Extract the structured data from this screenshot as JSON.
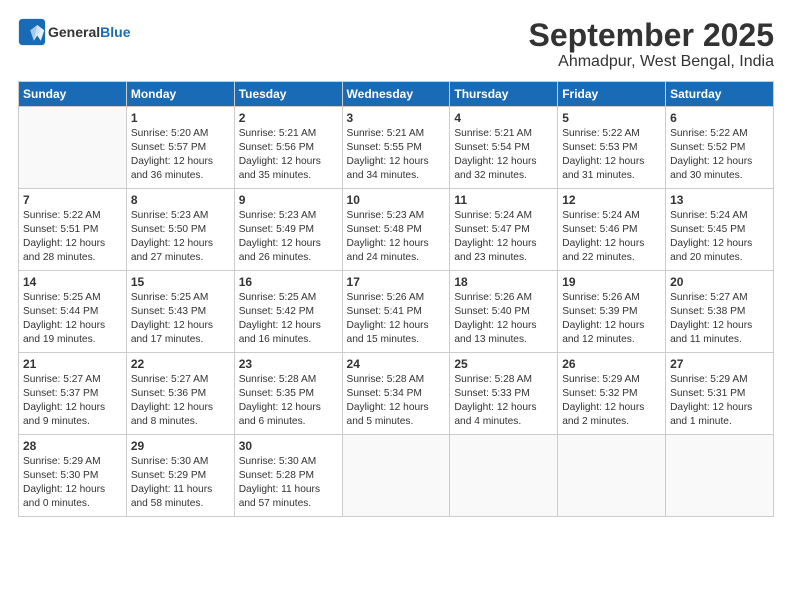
{
  "header": {
    "logo_general": "General",
    "logo_blue": "Blue",
    "month": "September 2025",
    "location": "Ahmadpur, West Bengal, India"
  },
  "days_of_week": [
    "Sunday",
    "Monday",
    "Tuesday",
    "Wednesday",
    "Thursday",
    "Friday",
    "Saturday"
  ],
  "weeks": [
    [
      {
        "day": "",
        "info": ""
      },
      {
        "day": "1",
        "info": "Sunrise: 5:20 AM\nSunset: 5:57 PM\nDaylight: 12 hours\nand 36 minutes."
      },
      {
        "day": "2",
        "info": "Sunrise: 5:21 AM\nSunset: 5:56 PM\nDaylight: 12 hours\nand 35 minutes."
      },
      {
        "day": "3",
        "info": "Sunrise: 5:21 AM\nSunset: 5:55 PM\nDaylight: 12 hours\nand 34 minutes."
      },
      {
        "day": "4",
        "info": "Sunrise: 5:21 AM\nSunset: 5:54 PM\nDaylight: 12 hours\nand 32 minutes."
      },
      {
        "day": "5",
        "info": "Sunrise: 5:22 AM\nSunset: 5:53 PM\nDaylight: 12 hours\nand 31 minutes."
      },
      {
        "day": "6",
        "info": "Sunrise: 5:22 AM\nSunset: 5:52 PM\nDaylight: 12 hours\nand 30 minutes."
      }
    ],
    [
      {
        "day": "7",
        "info": "Sunrise: 5:22 AM\nSunset: 5:51 PM\nDaylight: 12 hours\nand 28 minutes."
      },
      {
        "day": "8",
        "info": "Sunrise: 5:23 AM\nSunset: 5:50 PM\nDaylight: 12 hours\nand 27 minutes."
      },
      {
        "day": "9",
        "info": "Sunrise: 5:23 AM\nSunset: 5:49 PM\nDaylight: 12 hours\nand 26 minutes."
      },
      {
        "day": "10",
        "info": "Sunrise: 5:23 AM\nSunset: 5:48 PM\nDaylight: 12 hours\nand 24 minutes."
      },
      {
        "day": "11",
        "info": "Sunrise: 5:24 AM\nSunset: 5:47 PM\nDaylight: 12 hours\nand 23 minutes."
      },
      {
        "day": "12",
        "info": "Sunrise: 5:24 AM\nSunset: 5:46 PM\nDaylight: 12 hours\nand 22 minutes."
      },
      {
        "day": "13",
        "info": "Sunrise: 5:24 AM\nSunset: 5:45 PM\nDaylight: 12 hours\nand 20 minutes."
      }
    ],
    [
      {
        "day": "14",
        "info": "Sunrise: 5:25 AM\nSunset: 5:44 PM\nDaylight: 12 hours\nand 19 minutes."
      },
      {
        "day": "15",
        "info": "Sunrise: 5:25 AM\nSunset: 5:43 PM\nDaylight: 12 hours\nand 17 minutes."
      },
      {
        "day": "16",
        "info": "Sunrise: 5:25 AM\nSunset: 5:42 PM\nDaylight: 12 hours\nand 16 minutes."
      },
      {
        "day": "17",
        "info": "Sunrise: 5:26 AM\nSunset: 5:41 PM\nDaylight: 12 hours\nand 15 minutes."
      },
      {
        "day": "18",
        "info": "Sunrise: 5:26 AM\nSunset: 5:40 PM\nDaylight: 12 hours\nand 13 minutes."
      },
      {
        "day": "19",
        "info": "Sunrise: 5:26 AM\nSunset: 5:39 PM\nDaylight: 12 hours\nand 12 minutes."
      },
      {
        "day": "20",
        "info": "Sunrise: 5:27 AM\nSunset: 5:38 PM\nDaylight: 12 hours\nand 11 minutes."
      }
    ],
    [
      {
        "day": "21",
        "info": "Sunrise: 5:27 AM\nSunset: 5:37 PM\nDaylight: 12 hours\nand 9 minutes."
      },
      {
        "day": "22",
        "info": "Sunrise: 5:27 AM\nSunset: 5:36 PM\nDaylight: 12 hours\nand 8 minutes."
      },
      {
        "day": "23",
        "info": "Sunrise: 5:28 AM\nSunset: 5:35 PM\nDaylight: 12 hours\nand 6 minutes."
      },
      {
        "day": "24",
        "info": "Sunrise: 5:28 AM\nSunset: 5:34 PM\nDaylight: 12 hours\nand 5 minutes."
      },
      {
        "day": "25",
        "info": "Sunrise: 5:28 AM\nSunset: 5:33 PM\nDaylight: 12 hours\nand 4 minutes."
      },
      {
        "day": "26",
        "info": "Sunrise: 5:29 AM\nSunset: 5:32 PM\nDaylight: 12 hours\nand 2 minutes."
      },
      {
        "day": "27",
        "info": "Sunrise: 5:29 AM\nSunset: 5:31 PM\nDaylight: 12 hours\nand 1 minute."
      }
    ],
    [
      {
        "day": "28",
        "info": "Sunrise: 5:29 AM\nSunset: 5:30 PM\nDaylight: 12 hours\nand 0 minutes."
      },
      {
        "day": "29",
        "info": "Sunrise: 5:30 AM\nSunset: 5:29 PM\nDaylight: 11 hours\nand 58 minutes."
      },
      {
        "day": "30",
        "info": "Sunrise: 5:30 AM\nSunset: 5:28 PM\nDaylight: 11 hours\nand 57 minutes."
      },
      {
        "day": "",
        "info": ""
      },
      {
        "day": "",
        "info": ""
      },
      {
        "day": "",
        "info": ""
      },
      {
        "day": "",
        "info": ""
      }
    ]
  ]
}
